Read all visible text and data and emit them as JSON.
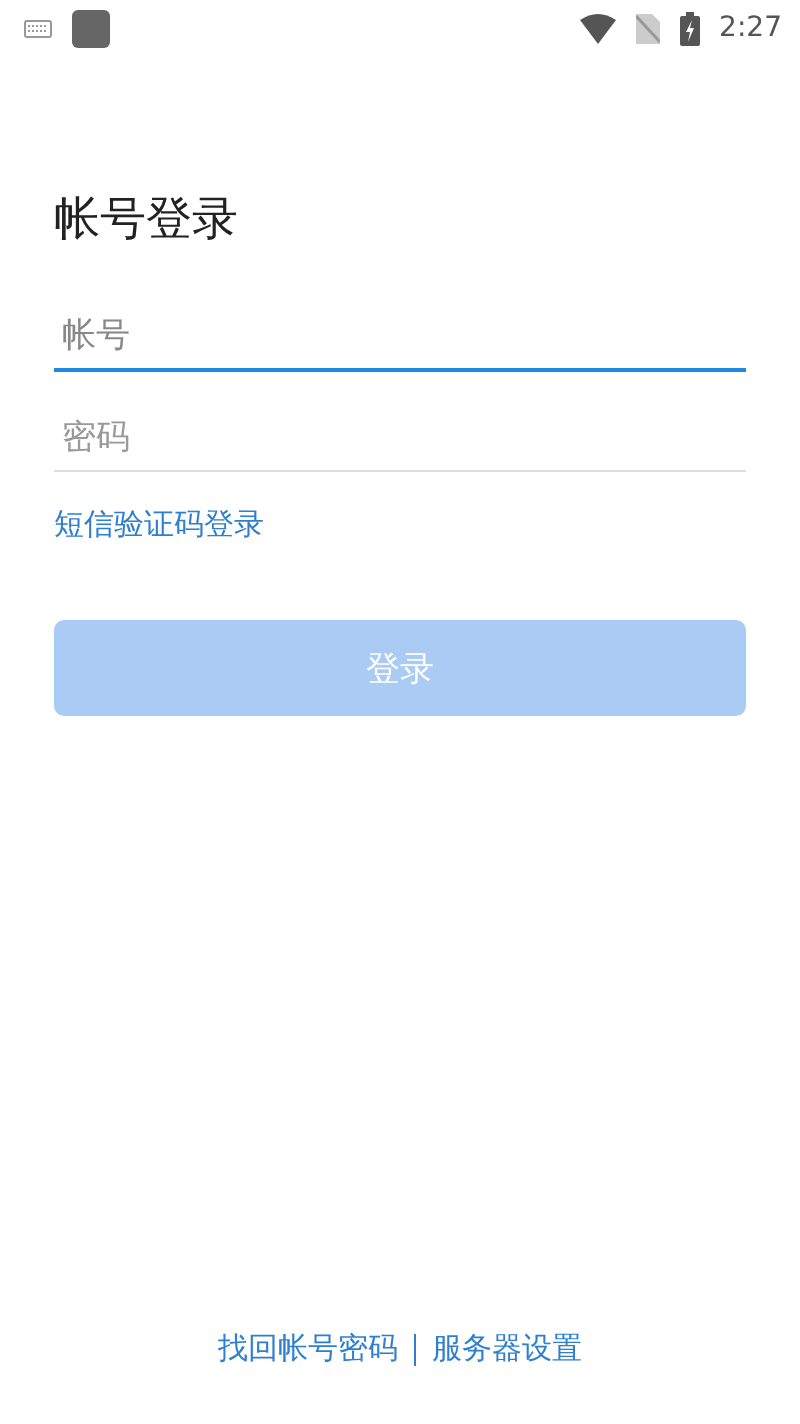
{
  "status_bar": {
    "time": "2:27"
  },
  "title": "帐号登录",
  "fields": [
    {
      "placeholder": "帐号",
      "focused": true
    },
    {
      "placeholder": "密码",
      "focused": false
    }
  ],
  "sms_link": "短信验证码登录",
  "login_button": {
    "label": "登录",
    "disabled": true
  },
  "footer_links": [
    "找回帐号密码",
    "服务器设置"
  ]
}
